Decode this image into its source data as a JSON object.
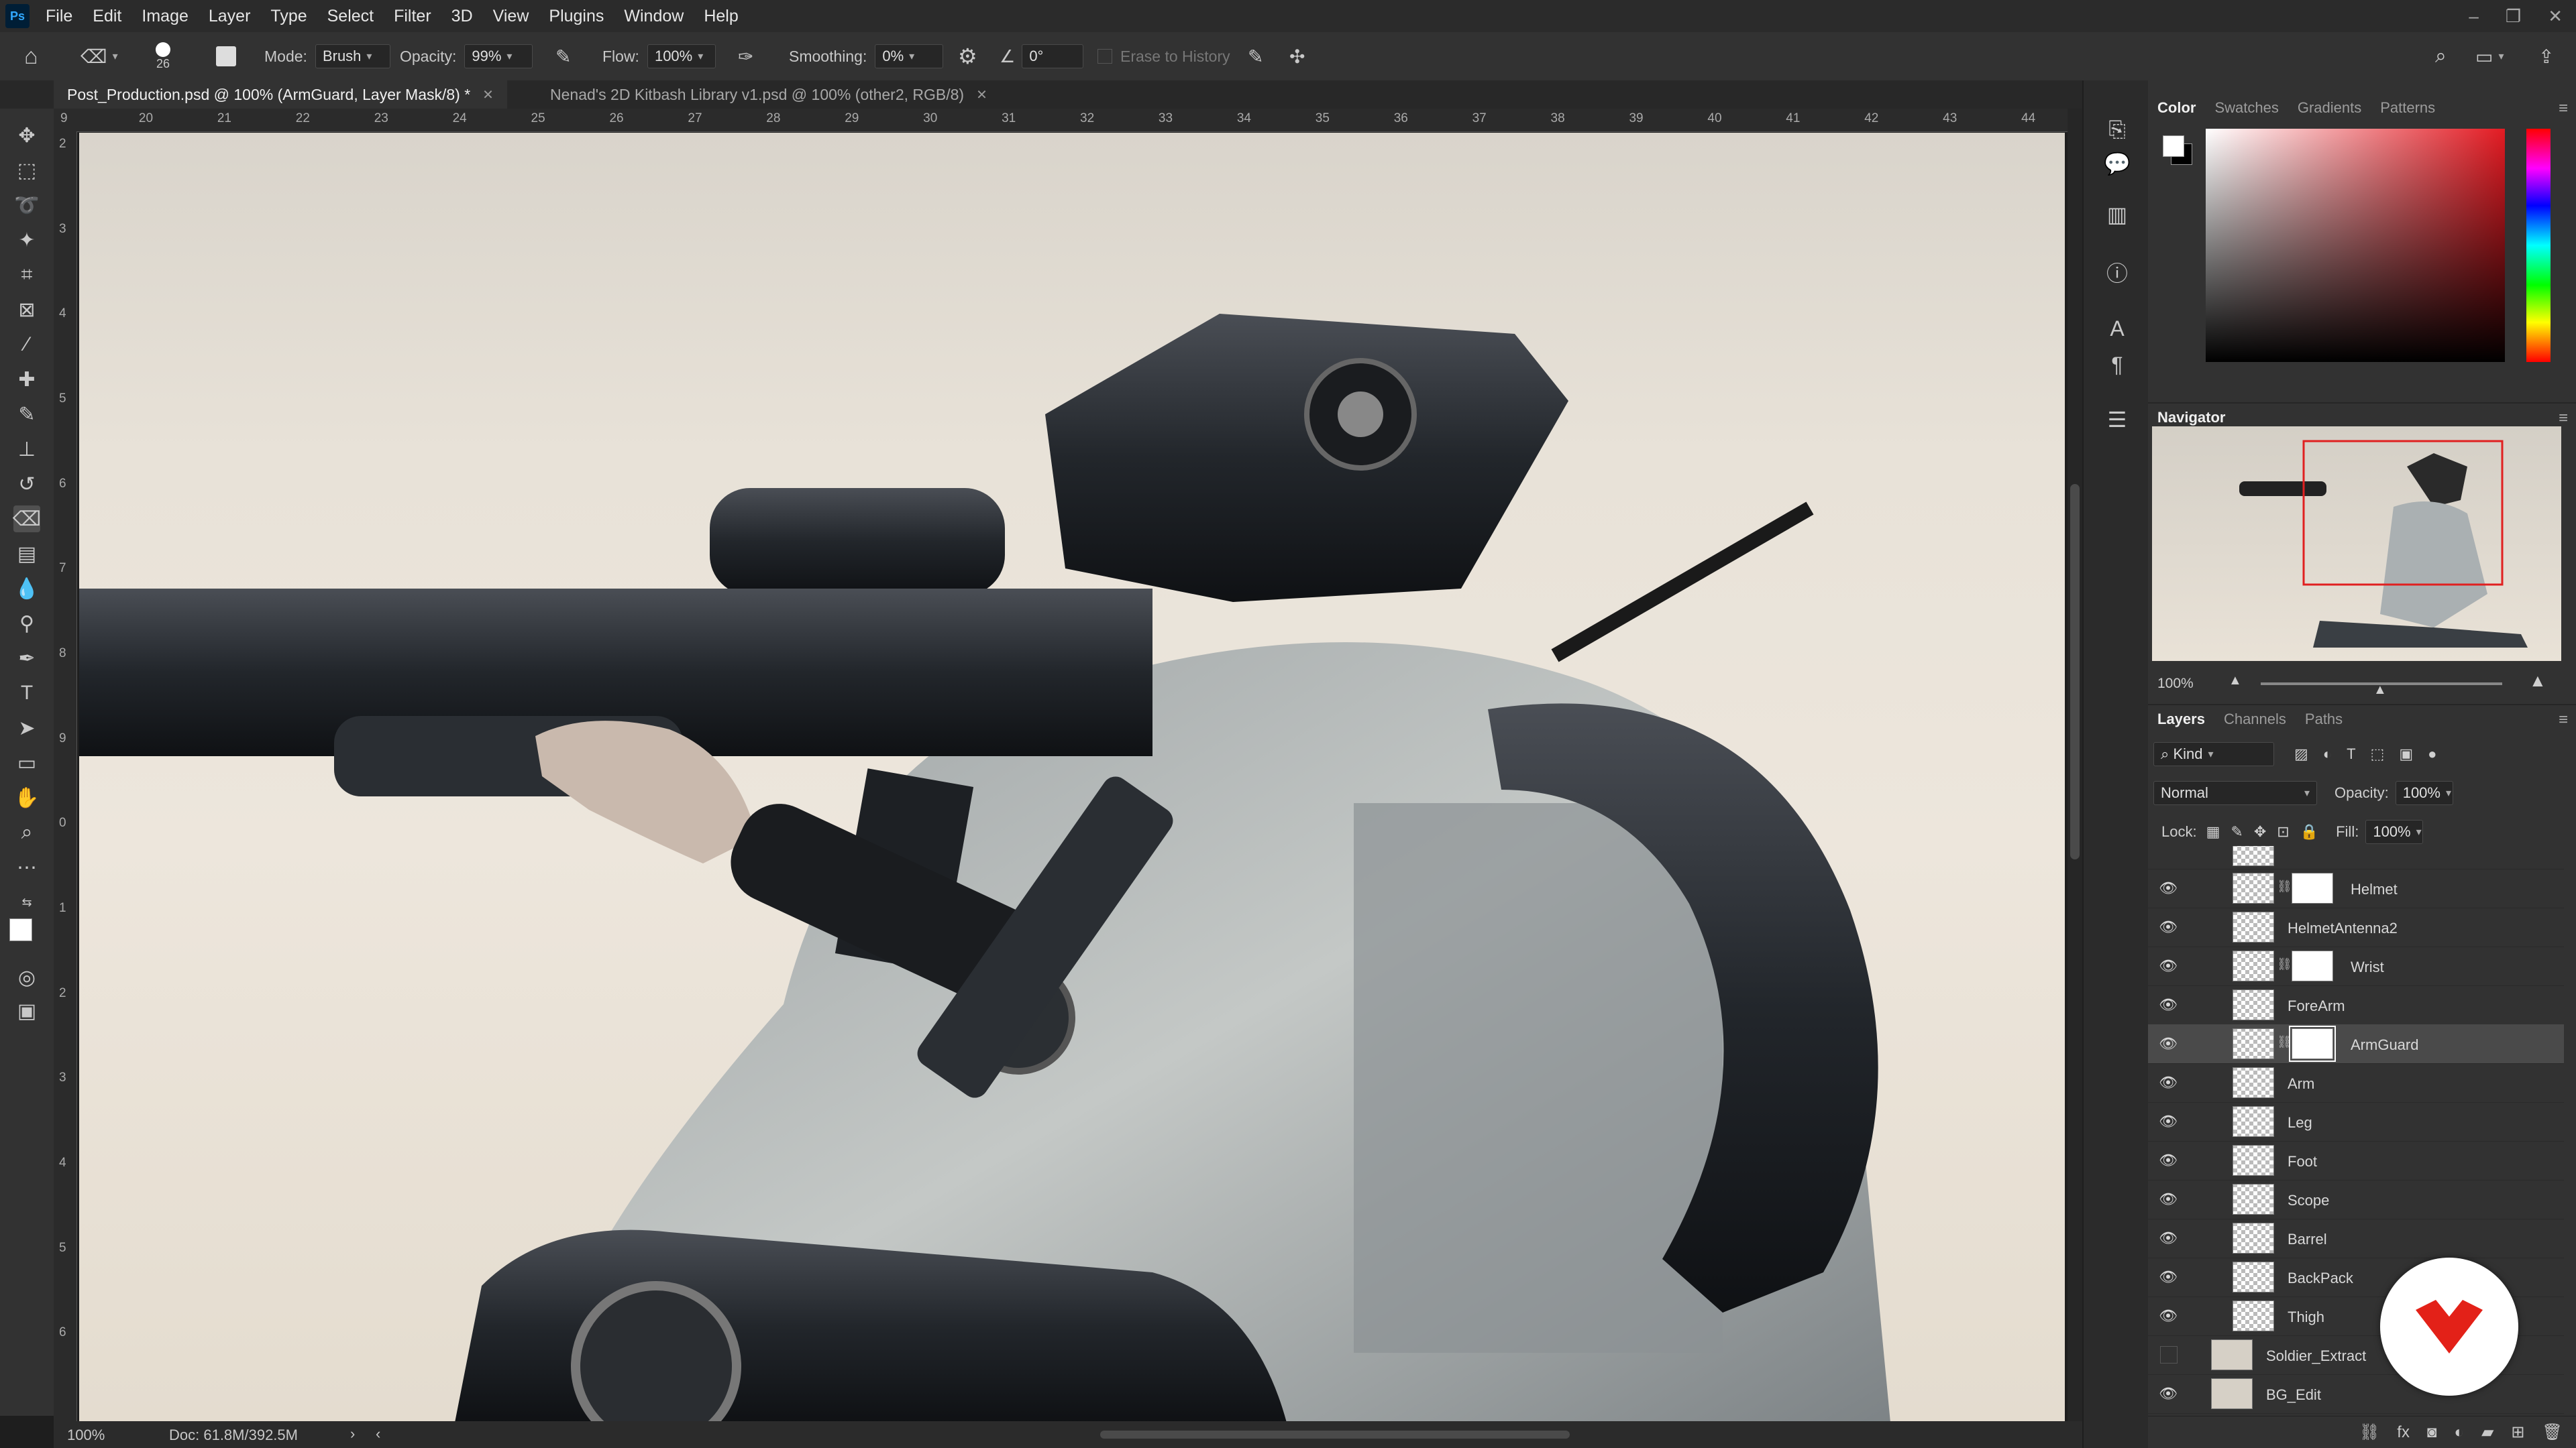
{
  "app": {
    "logo": "Ps"
  },
  "menu": [
    "File",
    "Edit",
    "Image",
    "Layer",
    "Type",
    "Select",
    "Filter",
    "3D",
    "View",
    "Plugins",
    "Window",
    "Help"
  ],
  "options": {
    "brush_size": "26",
    "mode_label": "Mode:",
    "mode_value": "Brush",
    "opacity_label": "Opacity:",
    "opacity_value": "99%",
    "flow_label": "Flow:",
    "flow_value": "100%",
    "smoothing_label": "Smoothing:",
    "smoothing_value": "0%",
    "angle_value": "0°",
    "erase_history": "Erase to History"
  },
  "tabs": [
    {
      "label": "Post_Production.psd @ 100% (ArmGuard, Layer Mask/8) *",
      "active": true
    },
    {
      "label": "Nenad's 2D Kitbash Library v1.psd @ 100% (other2, RGB/8)",
      "active": false
    }
  ],
  "ruler": {
    "h_ticks": [
      "9",
      "20",
      "21",
      "22",
      "23",
      "24",
      "25",
      "26",
      "27",
      "28",
      "29",
      "30",
      "31",
      "32",
      "33",
      "34",
      "35",
      "36",
      "37",
      "38",
      "39",
      "40",
      "41",
      "42",
      "43",
      "44"
    ],
    "v_ticks": [
      "2",
      "3",
      "4",
      "5",
      "6",
      "7",
      "8",
      "9",
      "0",
      "1",
      "2",
      "3",
      "4",
      "5",
      "6"
    ]
  },
  "status": {
    "zoom": "100%",
    "doc": "Doc: 61.8M/392.5M"
  },
  "color_panel": {
    "tabs": [
      "Color",
      "Swatches",
      "Gradients",
      "Patterns"
    ],
    "active": "Color",
    "foreground": "#ffffff",
    "background": "#000000"
  },
  "navigator": {
    "title": "Navigator",
    "zoom": "100%"
  },
  "layers_panel": {
    "tabs": [
      "Layers",
      "Channels",
      "Paths"
    ],
    "active": "Layers",
    "filter_kind": "Kind",
    "blend_mode": "Normal",
    "opacity_label": "Opacity:",
    "opacity_value": "100%",
    "lock_label": "Lock:",
    "fill_label": "Fill:",
    "fill_value": "100%",
    "layers": [
      {
        "name": "Helmet",
        "mask": true,
        "visible": true
      },
      {
        "name": "HelmetAntenna2",
        "mask": false,
        "visible": true
      },
      {
        "name": "Wrist",
        "mask": true,
        "visible": true
      },
      {
        "name": "ForeArm",
        "mask": false,
        "visible": true
      },
      {
        "name": "ArmGuard",
        "mask": true,
        "visible": true,
        "selected": true
      },
      {
        "name": "Arm",
        "mask": false,
        "visible": true
      },
      {
        "name": "Leg",
        "mask": false,
        "visible": true
      },
      {
        "name": "Foot",
        "mask": false,
        "visible": true
      },
      {
        "name": "Scope",
        "mask": false,
        "visible": true
      },
      {
        "name": "Barrel",
        "mask": false,
        "visible": true
      },
      {
        "name": "BackPack",
        "mask": false,
        "visible": true
      },
      {
        "name": "Thigh",
        "mask": false,
        "visible": true
      },
      {
        "name": "Soldier_Extract",
        "mask": false,
        "visible": false,
        "group_level": 0
      },
      {
        "name": "BG_Edit",
        "mask": false,
        "visible": true,
        "group_level": 0
      }
    ]
  }
}
